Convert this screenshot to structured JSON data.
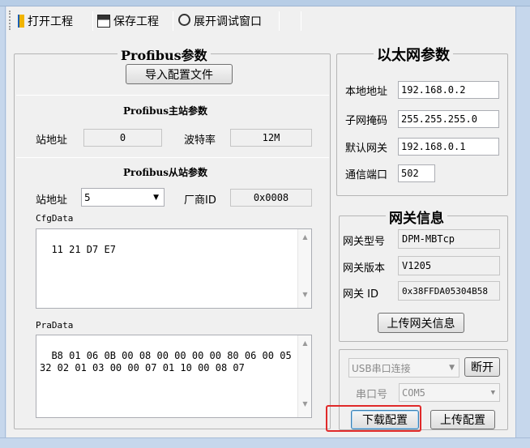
{
  "toolbar": {
    "open_project": "打开工程",
    "save_project": "保存工程",
    "expand_debug": "展开调试窗口"
  },
  "profibus": {
    "title": "Profibus参数",
    "import_config": "导入配置文件",
    "master_title": "Profibus主站参数",
    "master_station_label": "站地址",
    "master_station_value": "0",
    "baud_label": "波特率",
    "baud_value": "12M",
    "slave_title": "Profibus从站参数",
    "slave_station_label": "站地址",
    "slave_station_value": "5",
    "vendor_id_label": "厂商ID",
    "vendor_id_value": "0x0008",
    "cfg_label": "CfgData",
    "cfg_value": "11 21 D7 E7",
    "pra_label": "PraData",
    "pra_value": "B8 01 06 0B 00 08 00 00 00 00 80 06 00 05\n32 02 01 03 00 00 07 01 10 00 08 07"
  },
  "ethernet": {
    "title": "以太网参数",
    "local_ip_label": "本地地址",
    "local_ip_value": "192.168.0.2",
    "subnet_label": "子网掩码",
    "subnet_value": "255.255.255.0",
    "gateway_label": "默认网关",
    "gateway_value": "192.168.0.1",
    "port_label": "通信端口",
    "port_value": "502"
  },
  "gateway_info": {
    "title": "网关信息",
    "model_label": "网关型号",
    "model_value": "DPM-MBTcp",
    "version_label": "网关版本",
    "version_value": "V1205",
    "id_label": "网关 ID",
    "id_value": "0x38FFDA05304B58",
    "upload_info": "上传网关信息"
  },
  "connection": {
    "mode_value": "USB串口连接",
    "disconnect": "断开",
    "port_label": "串口号",
    "port_value": "COM5",
    "download_config": "下载配置",
    "upload_config": "上传配置"
  },
  "colors": {
    "highlight": "#e02a2a",
    "window_frame": "#c6d7ec",
    "client_bg": "#f0f0f0"
  }
}
